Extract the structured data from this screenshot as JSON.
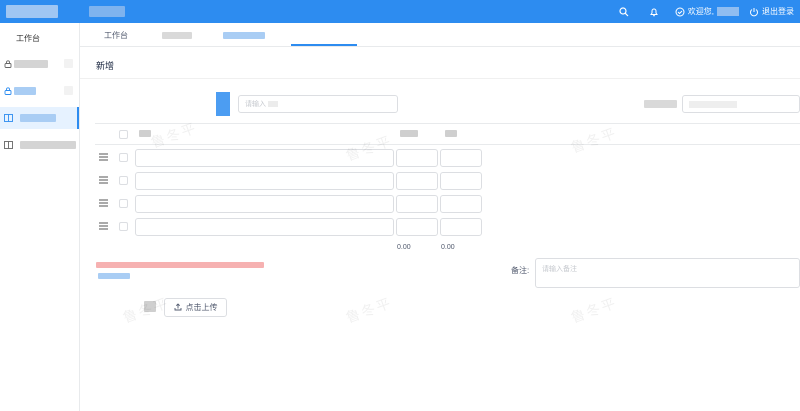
{
  "header": {
    "welcome_text": "欢迎您,",
    "logout_label": "退出登录"
  },
  "sidebar": {
    "title": "工作台"
  },
  "tabs": {
    "first_label": "工作台"
  },
  "page": {
    "title": "新增"
  },
  "form": {
    "search_placeholder": "请输入",
    "remark_label": "备注:",
    "remark_placeholder": "请输入备注",
    "upload_label": "点击上传"
  },
  "table": {
    "total_1": "0.00",
    "total_2": "0.00"
  },
  "watermark": {
    "text": "鲁冬平"
  },
  "colors": {
    "primary": "#2d8cf0",
    "border": "#dcdee2"
  }
}
